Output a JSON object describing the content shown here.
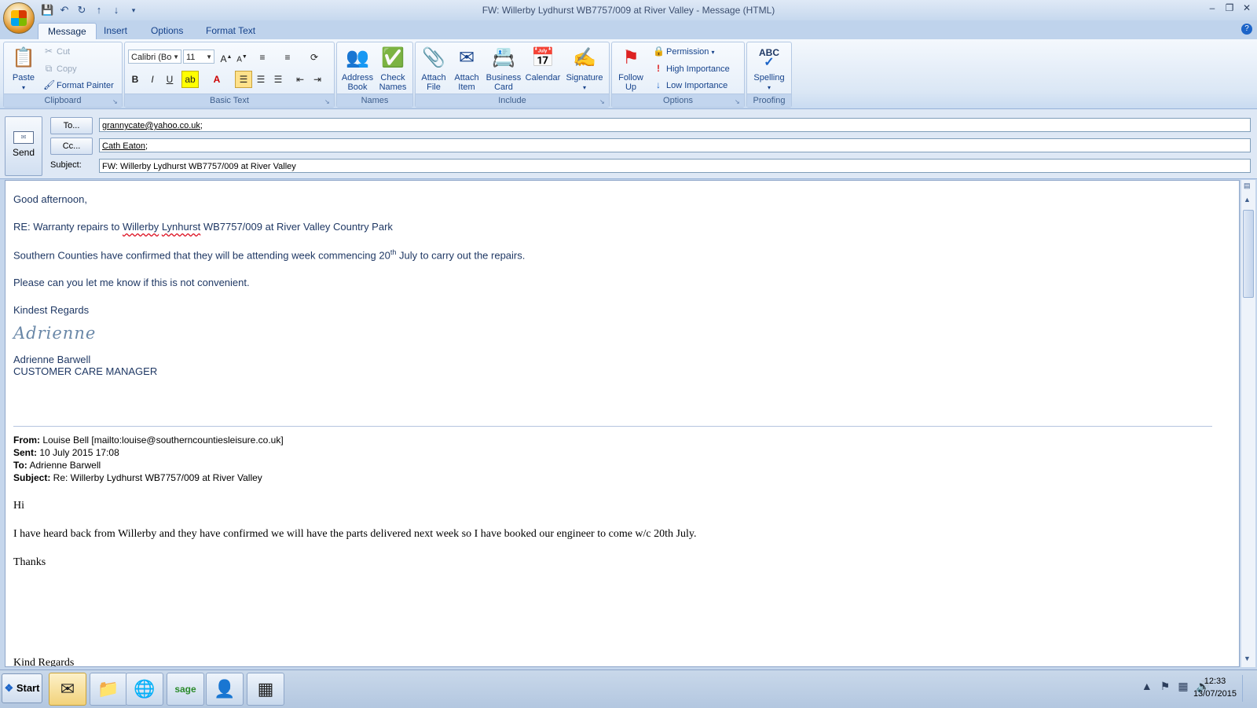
{
  "window": {
    "title": "FW: Willerby Lydhurst WB7757/009 at River Valley - Message (HTML)"
  },
  "qat": {
    "icons": [
      "save-icon",
      "undo-icon",
      "redo-icon",
      "up-arrow-icon",
      "down-arrow-icon",
      "customize-icon"
    ]
  },
  "tabs": [
    "Message",
    "Insert",
    "Options",
    "Format Text"
  ],
  "ribbon": {
    "clipboard": {
      "label": "Clipboard",
      "paste": "Paste",
      "cut": "Cut",
      "copy": "Copy",
      "format_painter": "Format Painter"
    },
    "basic_text": {
      "label": "Basic Text",
      "font": "Calibri (Bo",
      "size": "11",
      "bold": "B",
      "italic": "I",
      "underline": "U"
    },
    "names": {
      "label": "Names",
      "address_book_1": "Address",
      "address_book_2": "Book",
      "check_names_1": "Check",
      "check_names_2": "Names"
    },
    "include": {
      "label": "Include",
      "attach_file_1": "Attach",
      "attach_file_2": "File",
      "attach_item_1": "Attach",
      "attach_item_2": "Item",
      "business_card_1": "Business",
      "business_card_2": "Card",
      "calendar": "Calendar",
      "signature": "Signature"
    },
    "options": {
      "label": "Options",
      "follow_up_1": "Follow",
      "follow_up_2": "Up",
      "permission": "Permission",
      "high_importance": "High Importance",
      "low_importance": "Low Importance"
    },
    "proofing": {
      "label": "Proofing",
      "spelling": "Spelling",
      "abc": "ABC"
    }
  },
  "header": {
    "send": "Send",
    "to_btn": "To...",
    "cc_btn": "Cc...",
    "subject_label": "Subject:",
    "to_value": "grannycate@yahoo.co.uk",
    "cc_value": "Cath Eaton",
    "subject_value": "FW: Willerby Lydhurst WB7757/009 at River Valley"
  },
  "body": {
    "greeting": "Good afternoon,",
    "re_prefix": "RE: Warranty repairs to ",
    "re_w1": "Willerby",
    "re_w2": "Lynhurst",
    "re_suffix": " WB7757/009 at River Valley Country Park",
    "line2_pre": "Southern Counties have confirmed that they will be attending week commencing 20",
    "line2_sup": "th",
    "line2_post": " July to carry out the repairs.",
    "line3": "Please can you let me know if this is not convenient.",
    "regards": "Kindest Regards",
    "signature": "Adrienne",
    "sig_name": "Adrienne Barwell",
    "sig_title": "CUSTOMER CARE MANAGER",
    "from_label": "From:",
    "from_value": " Louise Bell [mailto:louise@southerncountiesleisure.co.uk]",
    "sent_label": "Sent:",
    "sent_value": " 10 July 2015 17:08",
    "to_label": "To:",
    "to_value": " Adrienne Barwell",
    "subject_label": "Subject:",
    "subject_value": " Re: Willerby Lydhurst WB7757/009 at River Valley",
    "reply_hi": "Hi",
    "reply_text": "I have heard back from Willerby and they have confirmed we will have the parts delivered next week so I have booked our engineer to come w/c 20th July.",
    "reply_thanks": "Thanks",
    "reply_cut": "Kind Regards"
  },
  "taskbar": {
    "start": "Start",
    "apps": [
      "outlook-icon",
      "folder-icon",
      "firefox-icon",
      "sage-icon",
      "contacts-icon",
      "calculator-icon"
    ],
    "time": "12:33",
    "date": "13/07/2015"
  }
}
